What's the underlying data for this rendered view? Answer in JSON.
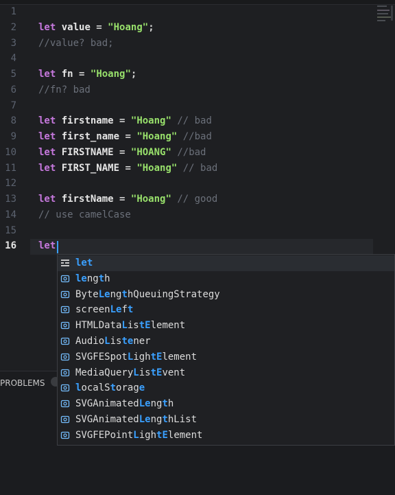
{
  "colors": {
    "keyword": "#c678dd",
    "string": "#98e06b",
    "comment": "#6b707a",
    "match_highlight": "#3aa0ff",
    "background": "#1e1f22"
  },
  "editor": {
    "active_line": 16,
    "lines": [
      {
        "n": "1",
        "tokens": []
      },
      {
        "n": "2",
        "tokens": [
          {
            "t": "let",
            "c": "kw"
          },
          {
            "t": " value",
            "c": "id"
          },
          {
            "t": " = ",
            "c": "op"
          },
          {
            "t": "\"Hoang\"",
            "c": "str"
          },
          {
            "t": ";",
            "c": "op"
          }
        ]
      },
      {
        "n": "3",
        "tokens": [
          {
            "t": "//value? bad;",
            "c": "cmt"
          }
        ]
      },
      {
        "n": "4",
        "tokens": []
      },
      {
        "n": "5",
        "tokens": [
          {
            "t": "let",
            "c": "kw"
          },
          {
            "t": " fn",
            "c": "id"
          },
          {
            "t": " = ",
            "c": "op"
          },
          {
            "t": "\"Hoang\"",
            "c": "str"
          },
          {
            "t": ";",
            "c": "op"
          }
        ]
      },
      {
        "n": "6",
        "tokens": [
          {
            "t": "//fn? bad",
            "c": "cmt"
          }
        ]
      },
      {
        "n": "7",
        "tokens": []
      },
      {
        "n": "8",
        "tokens": [
          {
            "t": "let",
            "c": "kw"
          },
          {
            "t": " firstname",
            "c": "id"
          },
          {
            "t": " = ",
            "c": "op"
          },
          {
            "t": "\"Hoang\"",
            "c": "str"
          },
          {
            "t": " // bad",
            "c": "cmt"
          }
        ]
      },
      {
        "n": "9",
        "tokens": [
          {
            "t": "let",
            "c": "kw"
          },
          {
            "t": " first_name",
            "c": "id"
          },
          {
            "t": " = ",
            "c": "op"
          },
          {
            "t": "\"Hoang\"",
            "c": "str"
          },
          {
            "t": " //bad",
            "c": "cmt"
          }
        ]
      },
      {
        "n": "10",
        "tokens": [
          {
            "t": "let",
            "c": "kw"
          },
          {
            "t": " FIRSTNAME",
            "c": "id"
          },
          {
            "t": " = ",
            "c": "op"
          },
          {
            "t": "\"HOANG\"",
            "c": "str"
          },
          {
            "t": " //bad",
            "c": "cmt"
          }
        ]
      },
      {
        "n": "11",
        "tokens": [
          {
            "t": "let",
            "c": "kw"
          },
          {
            "t": " FIRST_NAME",
            "c": "id"
          },
          {
            "t": " = ",
            "c": "op"
          },
          {
            "t": "\"Hoang\"",
            "c": "str"
          },
          {
            "t": " // bad",
            "c": "cmt"
          }
        ]
      },
      {
        "n": "12",
        "tokens": []
      },
      {
        "n": "13",
        "tokens": [
          {
            "t": "let",
            "c": "kw"
          },
          {
            "t": " firstName",
            "c": "id"
          },
          {
            "t": " = ",
            "c": "op"
          },
          {
            "t": "\"Hoang\"",
            "c": "str"
          },
          {
            "t": " // good",
            "c": "cmt"
          }
        ]
      },
      {
        "n": "14",
        "tokens": [
          {
            "t": "// use camelCase",
            "c": "cmt"
          }
        ]
      },
      {
        "n": "15",
        "tokens": []
      },
      {
        "n": "16",
        "tokens": [
          {
            "t": "let",
            "c": "kw"
          }
        ]
      }
    ]
  },
  "suggestions": {
    "selected_index": 0,
    "items": [
      {
        "icon": "keyword-snippet-icon",
        "parts": [
          {
            "t": "let",
            "h": true
          }
        ]
      },
      {
        "icon": "variable-icon",
        "parts": [
          {
            "t": "le",
            "h": true
          },
          {
            "t": "ng",
            "h": false
          },
          {
            "t": "t",
            "h": true
          },
          {
            "t": "h",
            "h": false
          }
        ]
      },
      {
        "icon": "variable-icon",
        "parts": [
          {
            "t": "Byte",
            "h": false
          },
          {
            "t": "Le",
            "h": true
          },
          {
            "t": "ng",
            "h": false
          },
          {
            "t": "t",
            "h": true
          },
          {
            "t": "hQueuingStrategy",
            "h": false
          }
        ]
      },
      {
        "icon": "variable-icon",
        "parts": [
          {
            "t": "screen",
            "h": false
          },
          {
            "t": "Le",
            "h": true
          },
          {
            "t": "f",
            "h": false
          },
          {
            "t": "t",
            "h": true
          }
        ]
      },
      {
        "icon": "variable-icon",
        "parts": [
          {
            "t": "HTMLData",
            "h": false
          },
          {
            "t": "L",
            "h": true
          },
          {
            "t": "is",
            "h": false
          },
          {
            "t": "tE",
            "h": true
          },
          {
            "t": "lement",
            "h": false
          }
        ]
      },
      {
        "icon": "variable-icon",
        "parts": [
          {
            "t": "Audio",
            "h": false
          },
          {
            "t": "L",
            "h": true
          },
          {
            "t": "is",
            "h": false
          },
          {
            "t": "te",
            "h": true
          },
          {
            "t": "ner",
            "h": false
          }
        ]
      },
      {
        "icon": "variable-icon",
        "parts": [
          {
            "t": "SVGFESpot",
            "h": false
          },
          {
            "t": "L",
            "h": true
          },
          {
            "t": "igh",
            "h": false
          },
          {
            "t": "tE",
            "h": true
          },
          {
            "t": "lement",
            "h": false
          }
        ]
      },
      {
        "icon": "variable-icon",
        "parts": [
          {
            "t": "MediaQuery",
            "h": false
          },
          {
            "t": "L",
            "h": true
          },
          {
            "t": "is",
            "h": false
          },
          {
            "t": "tE",
            "h": true
          },
          {
            "t": "vent",
            "h": false
          }
        ]
      },
      {
        "icon": "variable-icon",
        "parts": [
          {
            "t": "l",
            "h": true
          },
          {
            "t": "ocalS",
            "h": false
          },
          {
            "t": "t",
            "h": true
          },
          {
            "t": "orag",
            "h": false
          },
          {
            "t": "e",
            "h": true
          }
        ]
      },
      {
        "icon": "variable-icon",
        "parts": [
          {
            "t": "SVGAnimated",
            "h": false
          },
          {
            "t": "Le",
            "h": true
          },
          {
            "t": "ng",
            "h": false
          },
          {
            "t": "t",
            "h": true
          },
          {
            "t": "h",
            "h": false
          }
        ]
      },
      {
        "icon": "variable-icon",
        "parts": [
          {
            "t": "SVGAnimated",
            "h": false
          },
          {
            "t": "Le",
            "h": true
          },
          {
            "t": "ng",
            "h": false
          },
          {
            "t": "t",
            "h": true
          },
          {
            "t": "hList",
            "h": false
          }
        ]
      },
      {
        "icon": "variable-icon",
        "parts": [
          {
            "t": "SVGFEPoint",
            "h": false
          },
          {
            "t": "L",
            "h": true
          },
          {
            "t": "igh",
            "h": false
          },
          {
            "t": "tE",
            "h": true
          },
          {
            "t": "lement",
            "h": false
          }
        ]
      }
    ]
  },
  "panel": {
    "problems_tab": "PROBLEMS"
  }
}
